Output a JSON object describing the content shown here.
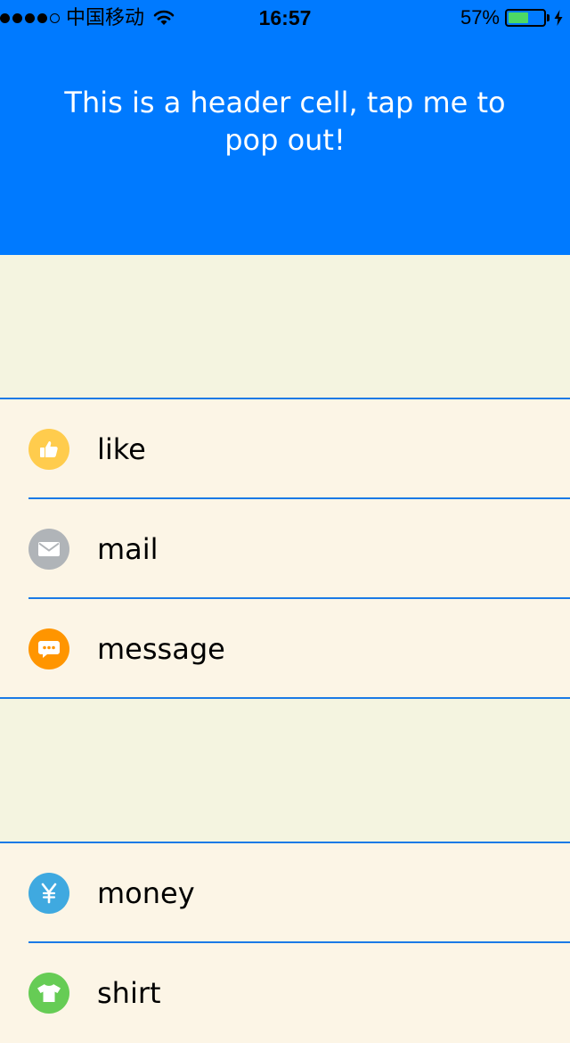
{
  "status_bar": {
    "carrier": "中国移动",
    "time": "16:57",
    "battery_percent": "57%",
    "battery_level": 0.57
  },
  "header": {
    "text": "This is a header cell, tap me to pop out!"
  },
  "sections": [
    {
      "items": [
        {
          "label": "like",
          "icon": "thumbs-up-icon",
          "color": "#ffcc4d"
        },
        {
          "label": "mail",
          "icon": "envelope-icon",
          "color": "#b0b4b8"
        },
        {
          "label": "message",
          "icon": "chat-bubble-icon",
          "color": "#ff9500"
        }
      ]
    },
    {
      "items": [
        {
          "label": "money",
          "icon": "yen-icon",
          "color": "#3fa9e0"
        },
        {
          "label": "shirt",
          "icon": "tshirt-icon",
          "color": "#66cc55"
        }
      ]
    }
  ],
  "colors": {
    "header_bg": "#007aff",
    "gap_bg": "#f4f4e0",
    "row_bg": "#fcf5e6",
    "separator": "#1a7ae6"
  }
}
